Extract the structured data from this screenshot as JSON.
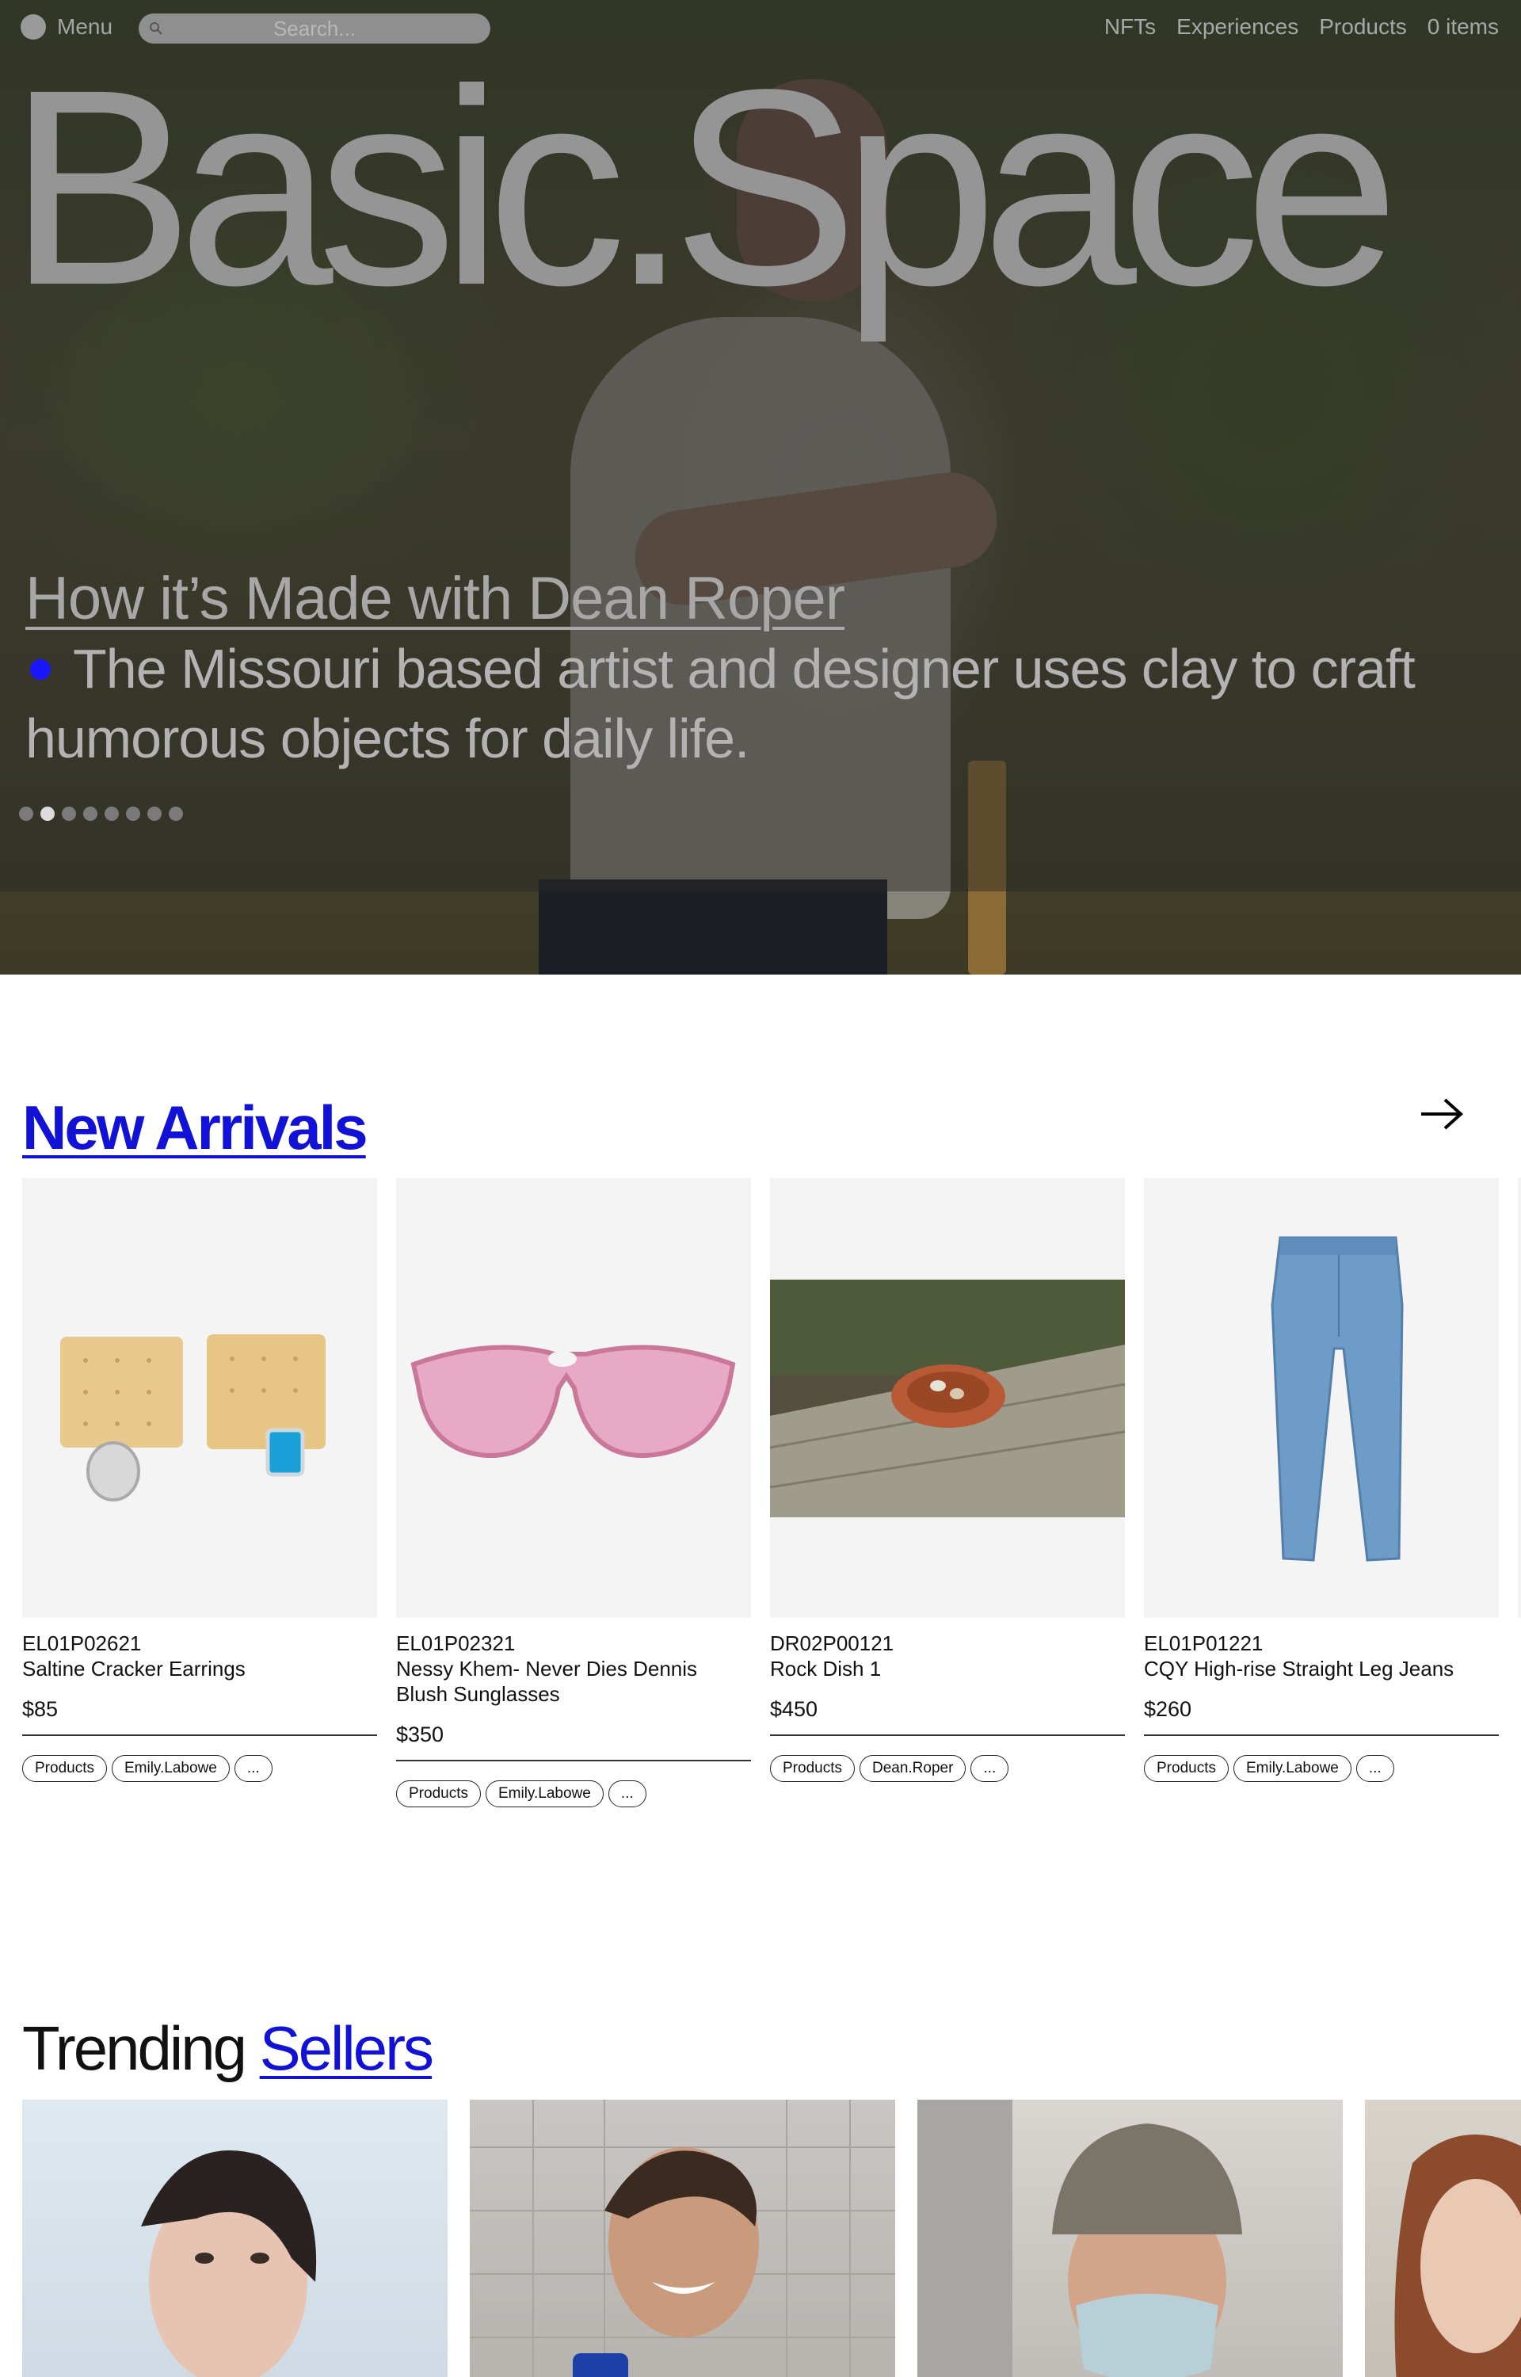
{
  "header": {
    "menu_label": "Menu",
    "search_placeholder": "Search...",
    "nav": [
      "NFTs",
      "Experiences",
      "Products"
    ],
    "cart_label": "0 items"
  },
  "hero": {
    "brand": "Basic.Space",
    "story_title": "How it’s Made with Dean Roper",
    "story_description": "The Missouri based artist and designer uses clay to craft humorous objects for daily life.",
    "slide_count": 8,
    "active_slide": 2
  },
  "new_arrivals": {
    "heading": "New Arrivals",
    "products": [
      {
        "sku": "EL01P02621",
        "name": "Saltine Cracker Earrings",
        "price": "$85",
        "tags": [
          "Products",
          "Emily.Labowe",
          "..."
        ]
      },
      {
        "sku": "EL01P02321",
        "name": "Nessy Khem- Never Dies Dennis Blush Sunglasses",
        "price": "$350",
        "tags": [
          "Products",
          "Emily.Labowe",
          "..."
        ]
      },
      {
        "sku": "DR02P00121",
        "name": "Rock Dish 1",
        "price": "$450",
        "tags": [
          "Products",
          "Dean.Roper",
          "..."
        ]
      },
      {
        "sku": "EL01P01221",
        "name": "CQY High-rise Straight Leg Jeans",
        "price": "$260",
        "tags": [
          "Products",
          "Emily.Labowe",
          "..."
        ]
      }
    ]
  },
  "trending": {
    "heading_plain": "Trending",
    "heading_link": "Sellers"
  },
  "colors": {
    "accent_blue": "#1212d6",
    "bullet_blue": "#1a17ff",
    "card_bg": "#f4f4f4"
  }
}
